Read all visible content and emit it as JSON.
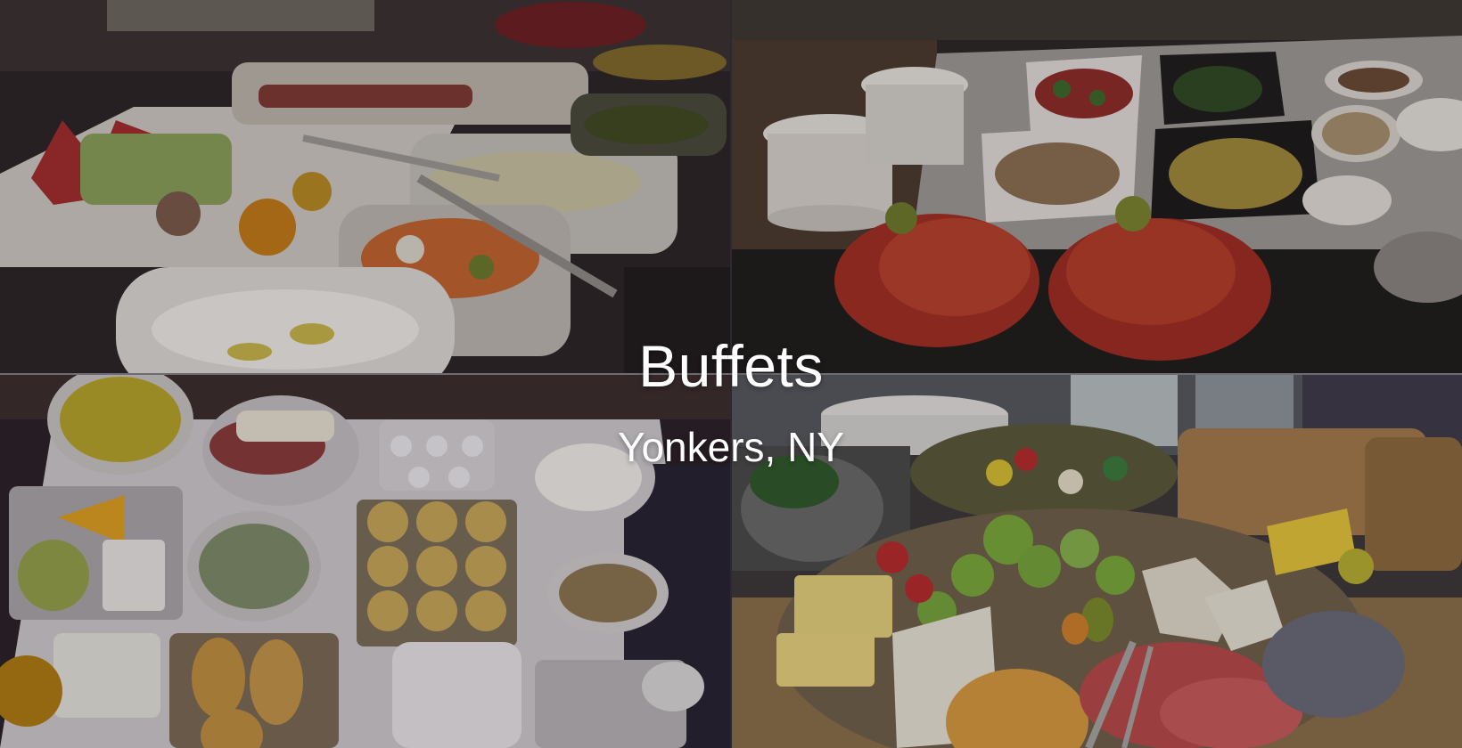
{
  "page": {
    "title": "Buffets",
    "subtitle": "Yonkers, NY"
  },
  "photos": [
    {
      "name": "photo-buffet-fruit-dips",
      "subject": "fruit platters, olives, dips and yogurt buffet"
    },
    {
      "name": "photo-buffet-crayfish",
      "subject": "crayfish platters, salads and plate stacks"
    },
    {
      "name": "photo-buffet-breakfast",
      "subject": "breakfast spread with muffins, croissants and cold cuts"
    },
    {
      "name": "photo-buffet-cheese-fruit",
      "subject": "cheese, grapes, salami and fruit board"
    }
  ],
  "colors": {
    "text": "#ffffff",
    "overlay": "#141218"
  }
}
